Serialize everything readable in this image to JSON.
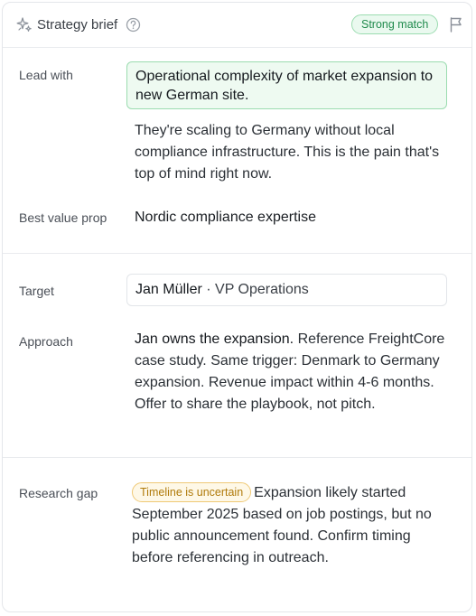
{
  "header": {
    "title": "Strategy brief",
    "match_badge": "Strong match"
  },
  "lead_with": {
    "label": "Lead with",
    "headline": "Operational complexity of market expansion to new German site.",
    "detail": "They're scaling to Germany without local compliance infrastructure. This is the pain that's top of mind right now."
  },
  "value_prop": {
    "label": "Best value prop",
    "value": "Nordic compliance expertise"
  },
  "target": {
    "label": "Target",
    "name": "Jan Müller",
    "separator": " · ",
    "role": "VP Operations"
  },
  "approach": {
    "label": "Approach",
    "lead": "Jan owns the expansion.",
    "body": " Reference FreightCore case study. Same trigger: Denmark to Germany expansion. Revenue impact within 4-6 months. Offer to share the playbook, not pitch."
  },
  "research_gap": {
    "label": "Research gap",
    "badge": "Timeline is uncertain",
    "body": "Expansion likely started September 2025 based on job postings, but no public announcement found. Confirm timing before referencing in outreach."
  },
  "colors": {
    "match_green": "#1f8a4c",
    "warn_amber": "#b07a0a"
  },
  "icons": {
    "header": "sparkle-icon",
    "help": "help-circle-icon",
    "flag": "flag-icon"
  }
}
